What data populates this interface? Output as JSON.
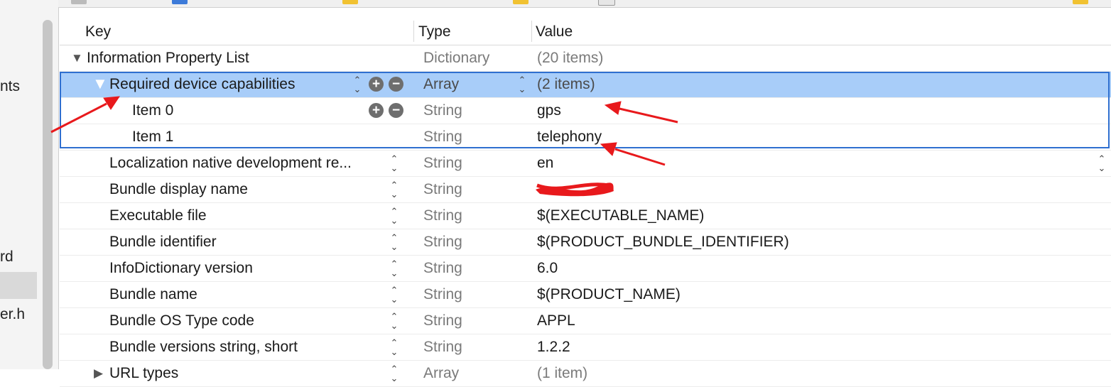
{
  "navigator": {
    "fragments": [
      "nts",
      "rd",
      "er.h"
    ]
  },
  "table": {
    "headers": {
      "key": "Key",
      "type": "Type",
      "value": "Value"
    },
    "rows": [
      {
        "key": "Information Property List",
        "type": "Dictionary",
        "value": "(20 items)",
        "level": 0,
        "disclosure": "expanded"
      },
      {
        "key": "Required device capabilities",
        "type": "Array",
        "value": "(2 items)",
        "level": 1,
        "disclosure": "expanded",
        "selected": true
      },
      {
        "key": "Item 0",
        "type": "String",
        "value": "gps",
        "level": 2
      },
      {
        "key": "Item 1",
        "type": "String",
        "value": "telephony",
        "level": 2
      },
      {
        "key": "Localization native development re...",
        "type": "String",
        "value": "en",
        "level": 1
      },
      {
        "key": "Bundle display name",
        "type": "String",
        "value": "",
        "level": 1,
        "redacted": true
      },
      {
        "key": "Executable file",
        "type": "String",
        "value": "$(EXECUTABLE_NAME)",
        "level": 1
      },
      {
        "key": "Bundle identifier",
        "type": "String",
        "value": "$(PRODUCT_BUNDLE_IDENTIFIER)",
        "level": 1
      },
      {
        "key": "InfoDictionary version",
        "type": "String",
        "value": "6.0",
        "level": 1
      },
      {
        "key": "Bundle name",
        "type": "String",
        "value": "$(PRODUCT_NAME)",
        "level": 1
      },
      {
        "key": "Bundle OS Type code",
        "type": "String",
        "value": "APPL",
        "level": 1
      },
      {
        "key": "Bundle versions string, short",
        "type": "String",
        "value": "1.2.2",
        "level": 1
      },
      {
        "key": "URL types",
        "type": "Array",
        "value": "(1 item)",
        "level": 1,
        "disclosure": "collapsed"
      }
    ]
  },
  "colors": {
    "selection": "#a8cdf9",
    "group_outline": "#2f6fd0",
    "annotation_arrow": "#e8191c"
  },
  "icons": {
    "expanded": "disclosure-down-icon",
    "collapsed": "disclosure-right-icon",
    "add": "plus-circle-icon",
    "remove": "minus-circle-icon",
    "stepper": "up-down-chevron-icon"
  }
}
